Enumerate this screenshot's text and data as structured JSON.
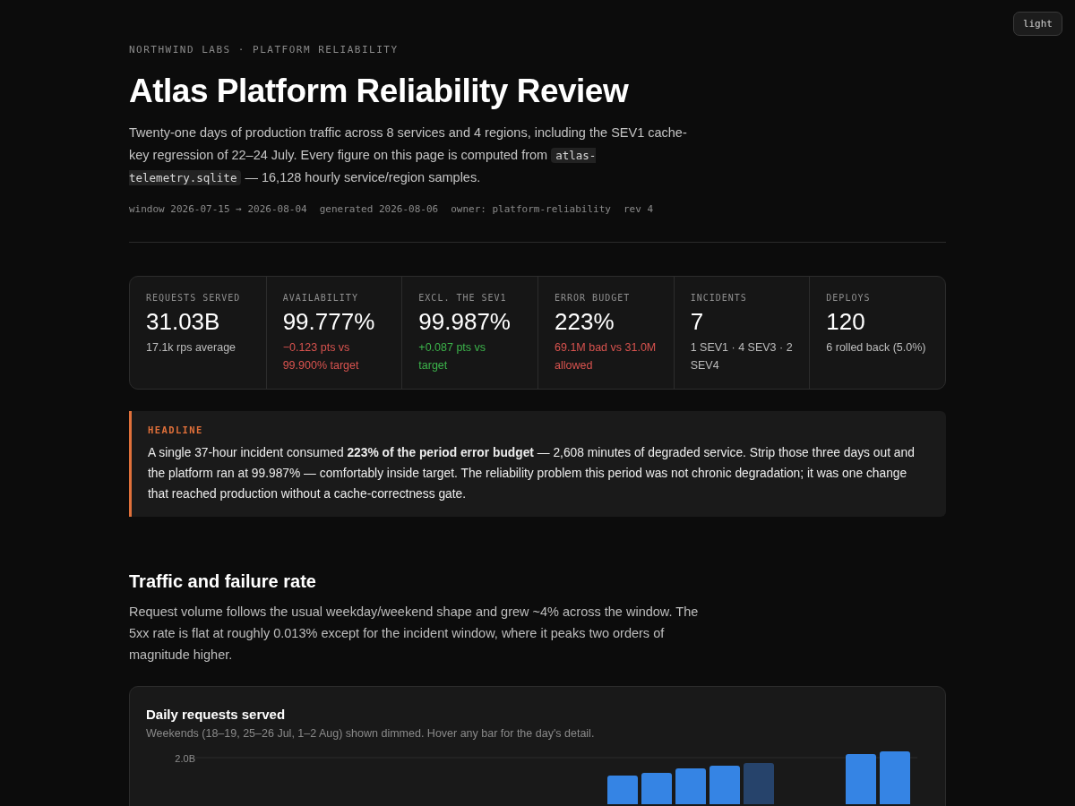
{
  "theme_toggle": {
    "label": "light"
  },
  "eyebrow": "NORTHWIND LABS · PLATFORM RELIABILITY",
  "title": "Atlas Platform Reliability Review",
  "intro": {
    "before": "Twenty-one days of production traffic across 8 services and 4 regions, including the SEV1 cache-key regression of 22–24 July. Every figure on this page is computed from",
    "code": "atlas-telemetry.sqlite",
    "after": "— 16,128 hourly service/region samples."
  },
  "meta": [
    "window 2026-07-15 → 2026-08-04",
    "generated 2026-08-06",
    "owner: platform-reliability",
    "rev 4"
  ],
  "stats": [
    {
      "label": "REQUESTS SERVED",
      "value": "31.03B",
      "note": "17.1k rps average",
      "color": "#bdbdbd"
    },
    {
      "label": "AVAILABILITY",
      "value": "99.777%",
      "note": "−0.123 pts vs 99.900% target",
      "color": "#d9534f"
    },
    {
      "label": "EXCL. THE SEV1",
      "value": "99.987%",
      "note": "+0.087 pts vs target",
      "color": "#3cb44b"
    },
    {
      "label": "ERROR BUDGET",
      "value": "223%",
      "note": "69.1M bad vs 31.0M allowed",
      "color": "#d9534f"
    },
    {
      "label": "INCIDENTS",
      "value": "7",
      "note": "1 SEV1 · 4 SEV3 · 2 SEV4",
      "color": "#bdbdbd"
    },
    {
      "label": "DEPLOYS",
      "value": "120",
      "note": "6 rolled back (5.0%)",
      "color": "#bdbdbd"
    }
  ],
  "headline": {
    "label": "HEADLINE",
    "text": "A single 37-hour incident consumed **223% of the period error budget** — 2,608 minutes of degraded service. Strip those three days out and the platform ran at 99.987% — comfortably inside target. The reliability problem this period was not chronic degradation; it was one change that reached production without a cache-correctness gate."
  },
  "section": {
    "title": "Traffic and failure rate",
    "text": "Request volume follows the usual weekday/weekend shape and grew ~4% across the window. The 5xx rate is flat at roughly 0.013% except for the incident window, where it peaks two orders of magnitude higher."
  },
  "chart_card": {
    "title": "Daily requests served",
    "subtitle": "Weekends (18–19, 25–26 Jul, 1–2 Aug) shown dimmed. Hover any bar for the day's detail.",
    "tick": "2.0B"
  }
}
